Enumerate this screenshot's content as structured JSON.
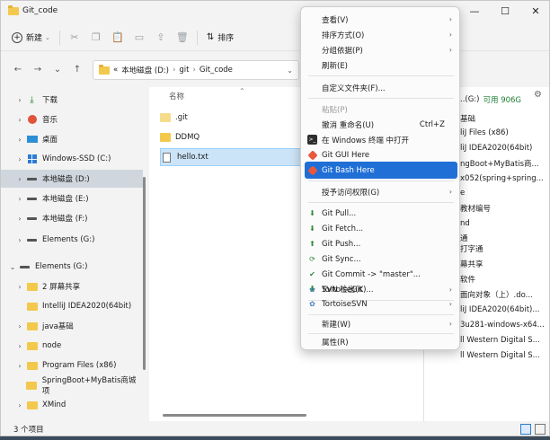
{
  "window": {
    "title": "Git_code",
    "controls": [
      "—",
      "☐",
      "✕"
    ]
  },
  "toolbar": {
    "new_label": "新建",
    "sort_label": "排序"
  },
  "address": {
    "prefix": "«",
    "crumbs": [
      "本地磁盘 (D:)",
      "git",
      "Git_code"
    ]
  },
  "nav": {
    "items": [
      {
        "label": "下载",
        "icon": "download-icon"
      },
      {
        "label": "音乐",
        "icon": "music-icon"
      },
      {
        "label": "桌面",
        "icon": "desktop-icon"
      },
      {
        "label": "Windows-SSD (C:)",
        "icon": "windows-drive-icon"
      },
      {
        "label": "本地磁盘 (D:)",
        "icon": "drive-icon",
        "selected": true
      },
      {
        "label": "本地磁盘 (E:)",
        "icon": "drive-icon"
      },
      {
        "label": "本地磁盘 (F:)",
        "icon": "drive-icon"
      },
      {
        "label": "Elements (G:)",
        "icon": "drive-icon"
      },
      {
        "label": "Elements (G:)",
        "icon": "drive-icon",
        "expanded": true
      },
      {
        "label": "2 屏幕共享",
        "icon": "folder-icon"
      },
      {
        "label": "IntelliJ IDEA2020(64bit)",
        "icon": "folder-icon"
      },
      {
        "label": "java基础",
        "icon": "folder-icon"
      },
      {
        "label": "node",
        "icon": "folder-icon"
      },
      {
        "label": "Program Files (x86)",
        "icon": "folder-icon"
      },
      {
        "label": "SpringBoot+MyBatis商城项",
        "icon": "folder-icon"
      },
      {
        "label": "XMind",
        "icon": "folder-icon"
      }
    ]
  },
  "content": {
    "column_name": "名称",
    "files": [
      {
        "name": ".git",
        "type": "folder-faded"
      },
      {
        "name": "DDMQ",
        "type": "folder"
      },
      {
        "name": "hello.txt",
        "type": "text",
        "selected": true
      }
    ]
  },
  "details": {
    "drive_label": "..(G:)",
    "free_label": "可用 906G",
    "items": [
      "基础",
      "liJ Files (x86)",
      "liJ IDEA2020(64bit)",
      "ngBoot+MyBatis商...",
      "x052(spring+spring...",
      "e",
      "教材编号",
      "nd",
      "通",
      "",
      "打字通",
      "幕共享",
      "软件",
      "面向对象（上）.do...",
      "liJ IDEA2020(64bit)...",
      "3u281-windows-x64...",
      "ll Western Digital S...",
      "ll Western Digital S..."
    ]
  },
  "status": {
    "count": "3 个项目"
  },
  "context_menu": {
    "items": [
      {
        "label": "查看(V)",
        "arrow": true
      },
      {
        "label": "排序方式(O)",
        "arrow": true
      },
      {
        "label": "分组依据(P)",
        "arrow": true
      },
      {
        "label": "刷新(E)"
      },
      {
        "sep": true
      },
      {
        "label": "自定义文件夹(F)..."
      },
      {
        "sep": true
      },
      {
        "label": "粘贴(P)",
        "disabled": true
      },
      {
        "label": "撤消 重命名(U)",
        "shortcut": "Ctrl+Z"
      },
      {
        "label": "在 Windows 终端 中打开",
        "icon": "terminal-icon"
      },
      {
        "label": "Git GUI Here",
        "icon": "git-gui-icon"
      },
      {
        "label": "Git Bash Here",
        "icon": "git-bash-icon",
        "highlight": true
      },
      {
        "sep": true
      },
      {
        "label": "授予访问权限(G)",
        "arrow": true
      },
      {
        "sep": true
      },
      {
        "label": "Git Pull...",
        "icon": "git-pull-icon"
      },
      {
        "label": "Git Fetch...",
        "icon": "git-fetch-icon"
      },
      {
        "label": "Git Push...",
        "icon": "git-push-icon"
      },
      {
        "label": "Git Sync...",
        "icon": "git-sync-icon"
      },
      {
        "label": "Git Commit -> \"master\"...",
        "icon": "git-commit-icon"
      },
      {
        "label": "TortoiseGit",
        "icon": "tortoisegit-icon",
        "arrow": true
      },
      {
        "sep": true
      },
      {
        "label": "SVN 检出(K)...",
        "icon": "svn-checkout-icon"
      },
      {
        "label": "TortoiseSVN",
        "icon": "tortoisesvn-icon",
        "arrow": true
      },
      {
        "sep": true
      },
      {
        "label": "新建(W)",
        "arrow": true
      },
      {
        "sep": true
      },
      {
        "label": "属性(R)"
      }
    ]
  },
  "colors": {
    "highlight": "#1f6fd6",
    "folder": "#f2c94c",
    "selection": "#cce4f7",
    "nav_selected": "#cfd6de"
  }
}
